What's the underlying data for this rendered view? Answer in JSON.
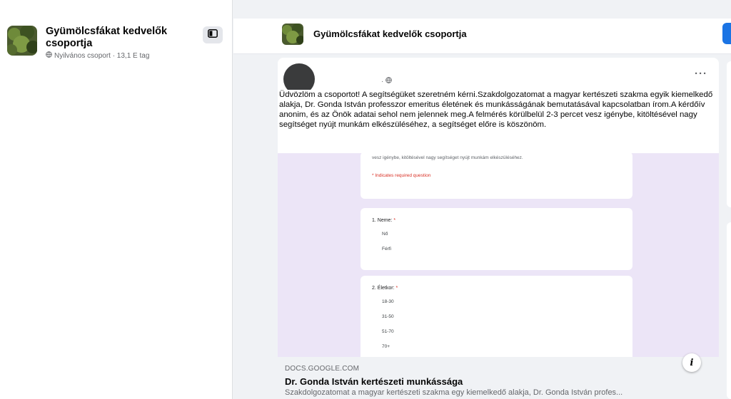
{
  "sidebar": {
    "group_name": "Gyümölcsfákat kedvelők csoportja",
    "group_meta": "Nyilvános csoport · 13,1 E tag"
  },
  "header": {
    "group_name": "Gyümölcsfákat kedvelők csoportja"
  },
  "post": {
    "meta": "· ",
    "more_label": "···",
    "text": "Üdvözlöm a csoportot! A segítségüket szeretném kérni.Szakdolgozatomat a magyar kertészeti szakma egyik kiemelkedő alakja, Dr. Gonda István professzor emeritus életének és munkásságának bemutatásával kapcsolatban írom.A kérdőív anonim, és az Önök adatai sehol nem jelennek meg.A felmérés körülbelül 2-3 percet vesz igénybe, kitöltésével nagy segítséget nyújt munkám elkészüléséhez, a segítséget előre is köszönöm.",
    "form": {
      "intro_tail": "vesz igénybe, kitöltésével nagy segítséget nyújt munkám elkészüléséhez.",
      "required_note": "* Indicates required question",
      "questions": [
        {
          "label": "1. Neme:",
          "required_mark": "*",
          "options": [
            "Nő",
            "Férfi"
          ]
        },
        {
          "label": "2. Életkor:",
          "required_mark": "*",
          "options": [
            "18-30",
            "31-50",
            "51-70",
            "70+"
          ]
        }
      ]
    },
    "info_label": "i",
    "link": {
      "domain": "DOCS.GOOGLE.COM",
      "title": "Dr. Gonda István kertészeti munkássága",
      "description": "Szakdolgozatomat a magyar kertészeti szakma egy kiemelkedő alakja, Dr. Gonda István profes..."
    }
  },
  "colors": {
    "accent": "#1b74e4",
    "form_background": "#ece5f7",
    "required_red": "#d93025"
  },
  "icons": [
    "globe-icon",
    "sidebar-toggle-icon",
    "more-options-icon",
    "info-icon"
  ]
}
